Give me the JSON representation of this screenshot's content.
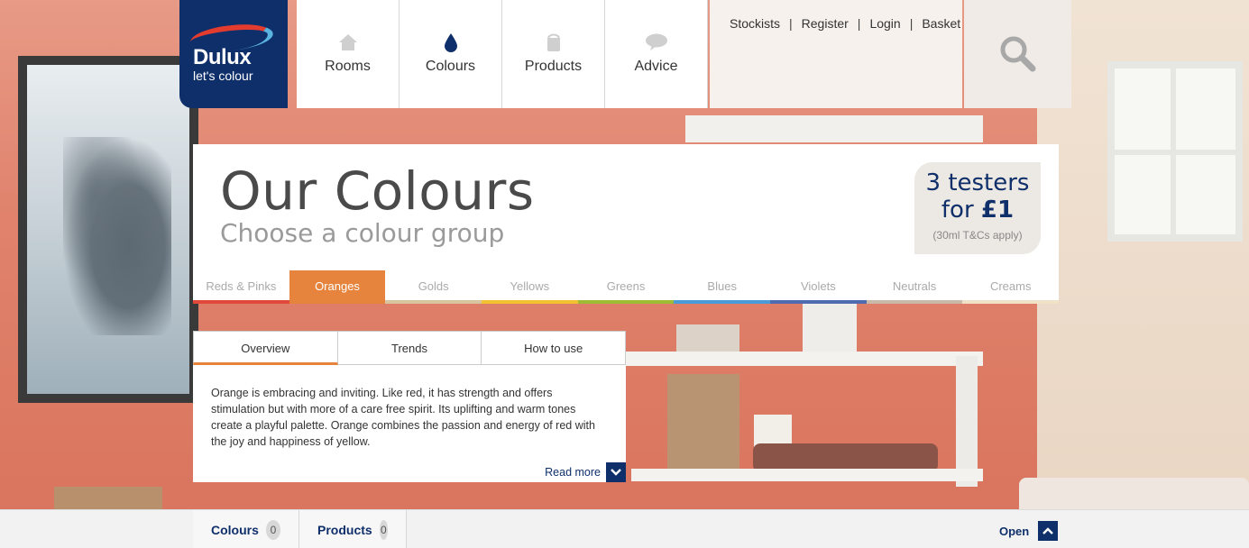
{
  "brand": {
    "name": "Dulux",
    "tagline": "let's colour"
  },
  "nav": {
    "items": [
      {
        "label": "Rooms",
        "icon": "house-icon"
      },
      {
        "label": "Colours",
        "icon": "drop-icon"
      },
      {
        "label": "Products",
        "icon": "paint-can-icon"
      },
      {
        "label": "Advice",
        "icon": "speech-bubble-icon"
      }
    ]
  },
  "util_links": [
    "Stockists",
    "Register",
    "Login",
    "Basket"
  ],
  "hero": {
    "title": "Our Colours",
    "subtitle": "Choose a colour group"
  },
  "promo": {
    "count": "3",
    "line1": "testers",
    "line2_prefix": "for",
    "price": "£1",
    "note": "(30ml T&Cs apply)"
  },
  "colour_groups": [
    {
      "label": "Reds & Pinks",
      "color": "#e0483a"
    },
    {
      "label": "Oranges",
      "color": "#e6843d",
      "active": true
    },
    {
      "label": "Golds",
      "color": "#d8c5a0"
    },
    {
      "label": "Yellows",
      "color": "#f2c232"
    },
    {
      "label": "Greens",
      "color": "#9dbb35"
    },
    {
      "label": "Blues",
      "color": "#4a9bd7"
    },
    {
      "label": "Violets",
      "color": "#4f6cb0"
    },
    {
      "label": "Neutrals",
      "color": "#c9b9a8"
    },
    {
      "label": "Creams",
      "color": "#efe2c6"
    }
  ],
  "subtabs": [
    "Overview",
    "Trends",
    "How to use"
  ],
  "overview_text": "Orange is embracing and inviting. Like red, it has strength and offers stimulation but with more of a care free spirit. Its uplifting and warm tones create a playful palette. Orange combines the passion and energy of red with the joy and happiness of yellow.",
  "read_more": "Read more",
  "bottom_bar": {
    "tabs": [
      {
        "label": "Colours",
        "count": "0"
      },
      {
        "label": "Products",
        "count": "0"
      }
    ],
    "open_label": "Open"
  },
  "colors": {
    "brand_navy": "#0f2f6b",
    "accent_orange": "#e6843d"
  }
}
